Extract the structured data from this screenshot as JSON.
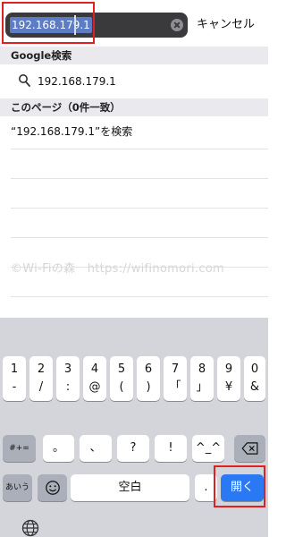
{
  "search": {
    "url_text": "192.168.179.1",
    "cancel_label": "キャンセル"
  },
  "google_section": {
    "header": "Google検索",
    "suggestion": "192.168.179.1"
  },
  "page_section": {
    "header": "このページ（0件一致）",
    "find_text": "“192.168.179.1”を検索"
  },
  "watermark": "©Wi-Fiの森　https://wifinomori.com",
  "keyboard": {
    "row1": [
      "1",
      "2",
      "3",
      "4",
      "5",
      "6",
      "7",
      "8",
      "9",
      "0"
    ],
    "row2": [
      "-",
      "/",
      ":",
      "@",
      "(",
      ")",
      "「",
      "」",
      "¥",
      "&"
    ],
    "row3_shift": "#+=",
    "row3": [
      "。",
      "、",
      "?",
      "!",
      "^_^"
    ],
    "row4_lang": "あいう",
    "space_label": "空白",
    "period": ".",
    "open_label": "開く"
  },
  "icons": {
    "clear": "clear-x-icon",
    "search": "search-icon",
    "emoji": "emoji-icon",
    "backspace": "backspace-icon",
    "globe": "globe-icon"
  },
  "colors": {
    "open_key": "#2a78f3",
    "highlight_border": "#e02020",
    "text_selection": "#5c7cc4"
  }
}
